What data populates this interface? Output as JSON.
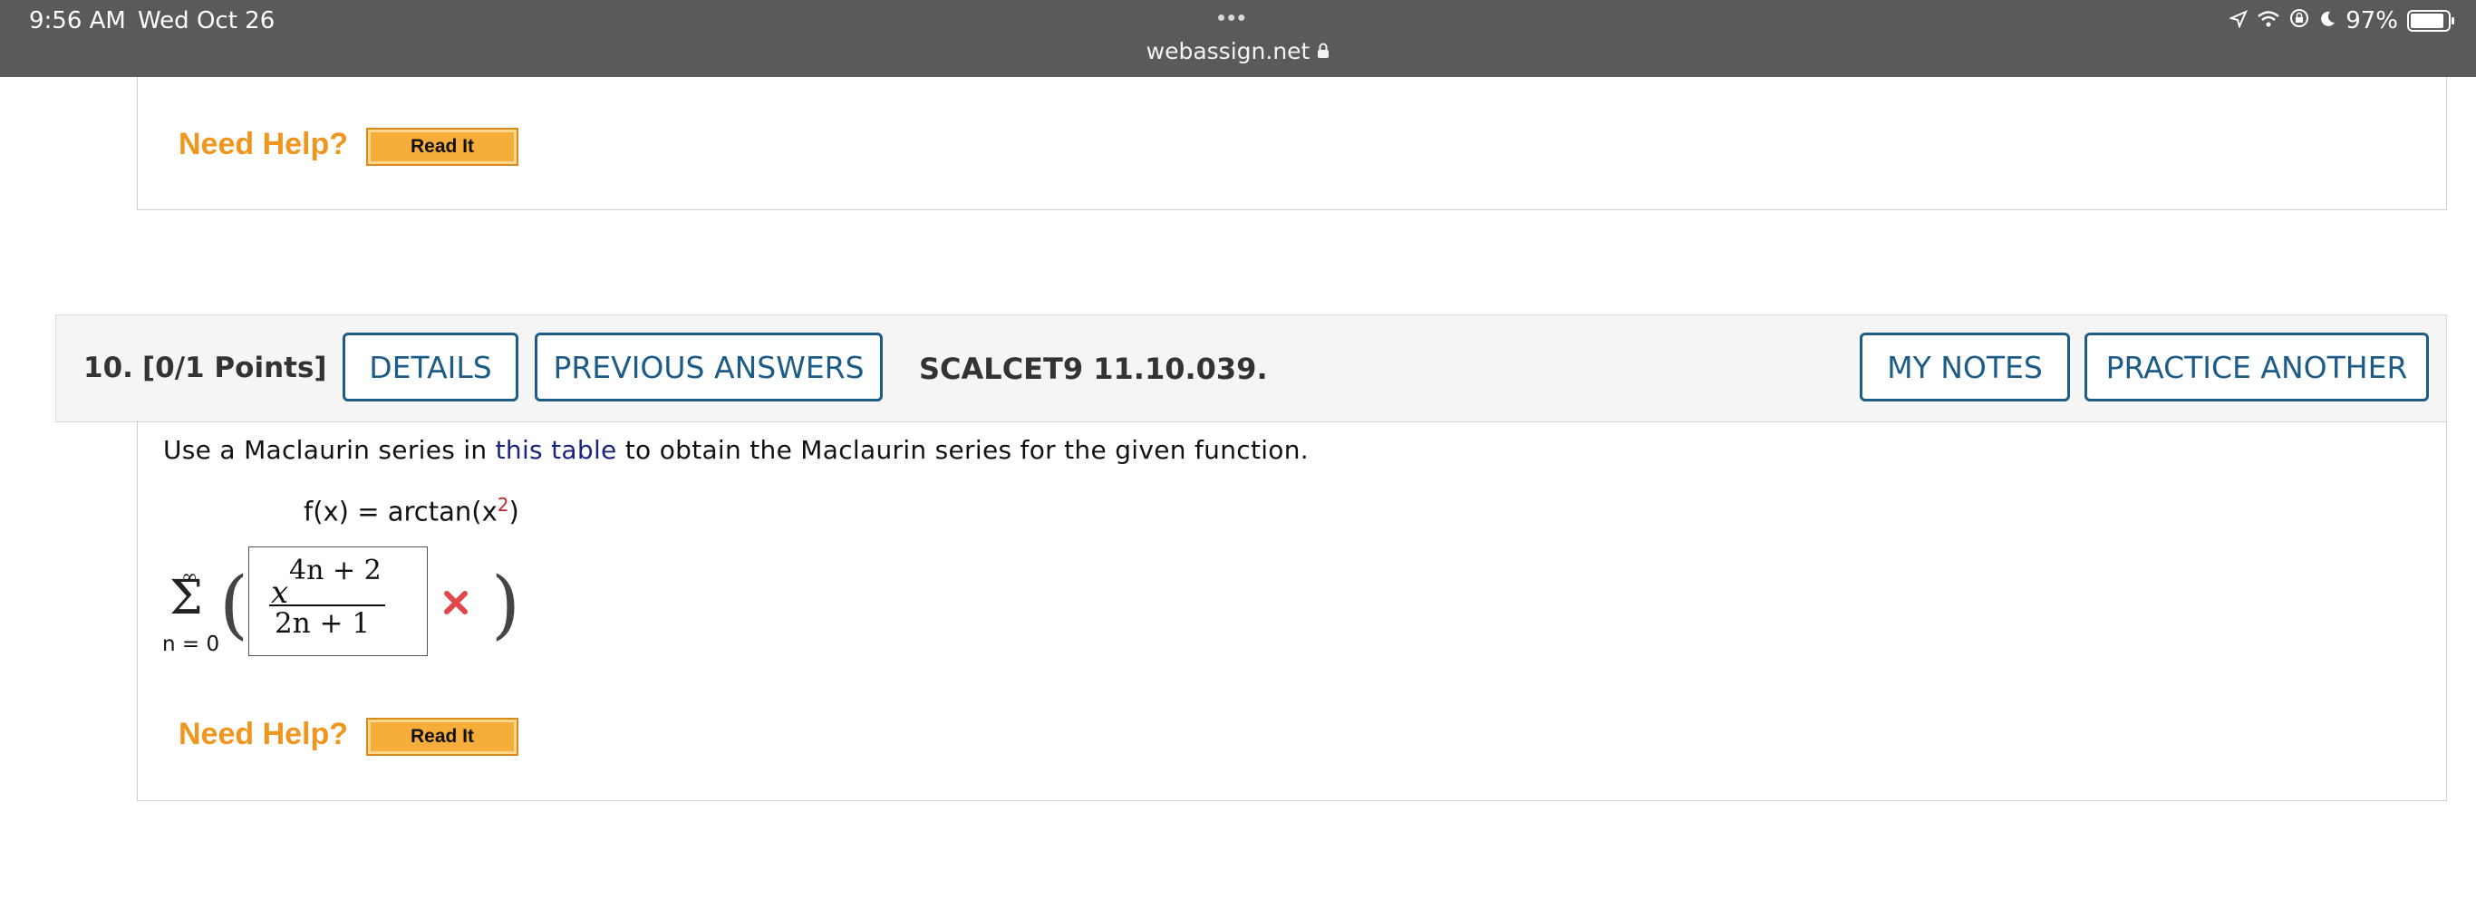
{
  "status_bar": {
    "time": "9:56 AM",
    "date": "Wed Oct 26",
    "url": "webassign.net",
    "battery": "97%"
  },
  "previous_question": {
    "need_help": "Need Help?",
    "read_it": "Read It"
  },
  "question": {
    "number": "10.",
    "points": "[0/1 Points]",
    "details_button": "DETAILS",
    "previous_answers_button": "PREVIOUS ANSWERS",
    "reference": "SCALCET9 11.10.039.",
    "my_notes_button": "MY NOTES",
    "practice_another_button": "PRACTICE ANOTHER",
    "prompt_before": "Use a Maclaurin series in ",
    "prompt_link": "this table",
    "prompt_after": " to obtain the Maclaurin series for the given function.",
    "function_lhs": "f(x) = arctan(x",
    "function_exp": "2",
    "function_close": ")",
    "sum_upper": "∞",
    "sum_symbol": "Σ",
    "sum_lower": "n = 0",
    "answer_base": "x",
    "answer_exponent": "4n + 2",
    "answer_denominator": "2n + 1",
    "answer_status": "incorrect",
    "need_help": "Need Help?",
    "read_it": "Read It"
  },
  "colors": {
    "header_bar": "#5a5a5a",
    "button_border": "#1d5c87",
    "need_help": "#f0961e",
    "read_it_bg": "#f7ad3a",
    "wrong_mark": "#e0474c",
    "link": "#1a237e"
  }
}
